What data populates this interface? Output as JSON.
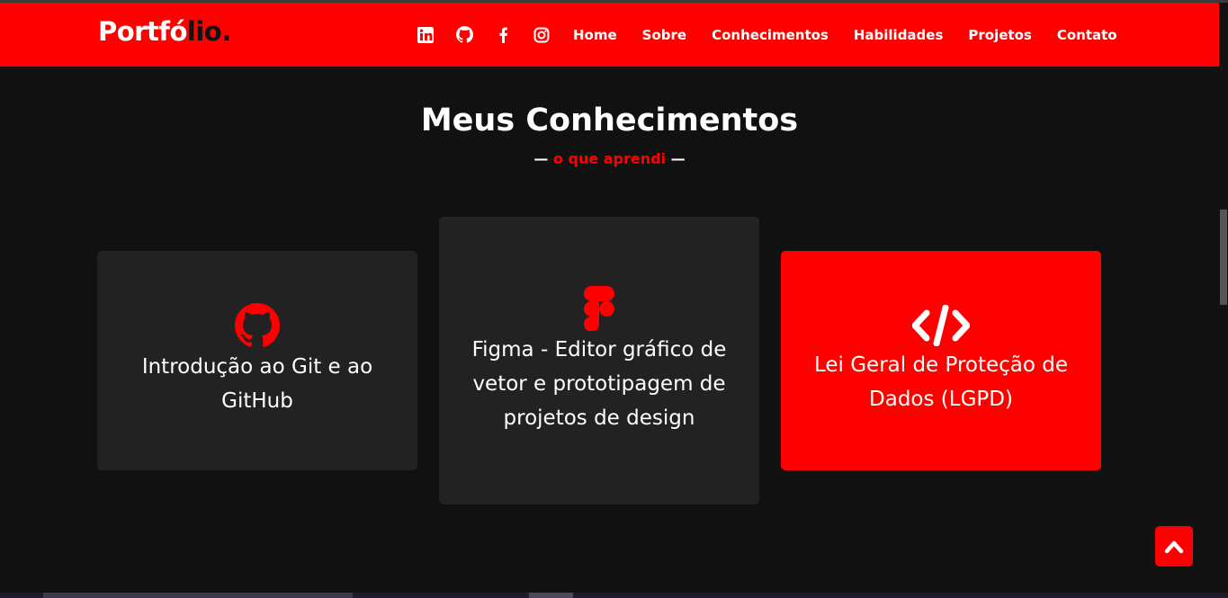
{
  "header": {
    "logo_main": "Portfó",
    "logo_accent": "lio.",
    "social_icons": [
      "linkedin-icon",
      "github-icon",
      "facebook-icon",
      "instagram-icon"
    ],
    "menu": [
      "Home",
      "Sobre",
      "Conhecimentos",
      "Habilidades",
      "Projetos",
      "Contato"
    ]
  },
  "section": {
    "title": "Meus Conhecimentos",
    "dash_left": "—",
    "subtitle": "o que aprendi",
    "dash_right": "—"
  },
  "cards": [
    {
      "icon": "github-icon",
      "text": "Introdução ao Git e ao GitHub"
    },
    {
      "icon": "figma-icon",
      "text": "Figma - Editor gráfico de vetor e prototipagem de projetos de design"
    },
    {
      "icon": "code-icon",
      "text": "Lei Geral de Proteção de Dados (LGPD)"
    }
  ],
  "colors": {
    "accent": "#ff0000",
    "background": "#111111",
    "card": "#222222"
  }
}
